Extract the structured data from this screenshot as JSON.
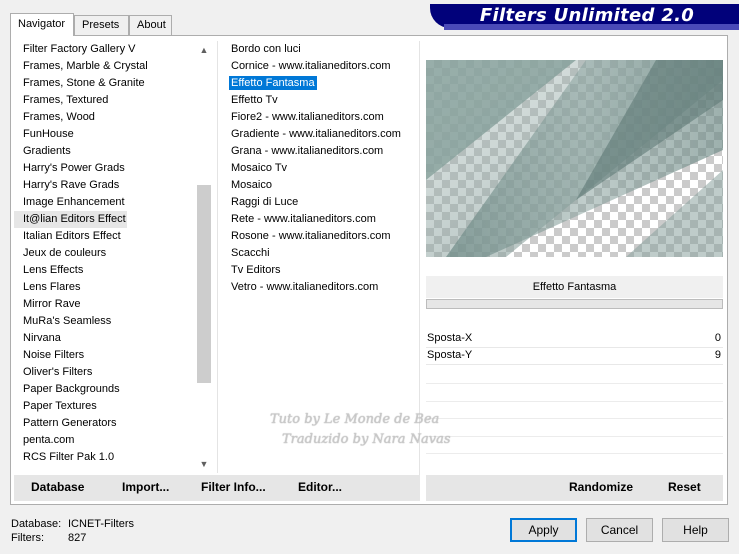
{
  "banner": {
    "title": "Filters Unlimited 2.0"
  },
  "tabs": [
    {
      "label": "Navigator",
      "active": true
    },
    {
      "label": "Presets",
      "active": false
    },
    {
      "label": "About",
      "active": false
    }
  ],
  "categories": [
    "Filter Factory Gallery V",
    "Frames, Marble & Crystal",
    "Frames, Stone & Granite",
    "Frames, Textured",
    "Frames, Wood",
    "FunHouse",
    "Gradients",
    "Harry's Power Grads",
    "Harry's Rave Grads",
    "Image Enhancement",
    "It@lian Editors Effect",
    "Italian Editors Effect",
    "Jeux de couleurs",
    "Lens Effects",
    "Lens Flares",
    "Mirror Rave",
    "MuRa's Seamless",
    "Nirvana",
    "Noise Filters",
    "Oliver's Filters",
    "Paper Backgrounds",
    "Paper Textures",
    "Pattern Generators",
    "penta.com",
    "RCS Filter Pak 1.0"
  ],
  "selected_category_index": 10,
  "filters": [
    "Bordo con luci",
    "Cornice - www.italianeditors.com",
    "Effetto Fantasma",
    "Effetto Tv",
    "Fiore2 - www.italianeditors.com",
    "Gradiente - www.italianeditors.com",
    "Grana - www.italianeditors.com",
    "Mosaico Tv",
    "Mosaico",
    "Raggi di Luce",
    "Rete - www.italianeditors.com",
    "Rosone - www.italianeditors.com",
    "Scacchi",
    "Tv Editors",
    "Vetro - www.italianeditors.com"
  ],
  "selected_filter_index": 2,
  "preview": {
    "filter_name": "Effetto Fantasma",
    "progress": 0
  },
  "params": [
    {
      "label": "Sposta-X",
      "value": "0"
    },
    {
      "label": "Sposta-Y",
      "value": "9"
    }
  ],
  "watermark": {
    "line1": "Tuto by Le Monde de Bea",
    "line2": "Traduzido by Nara Navas"
  },
  "toolbar": {
    "database": "Database",
    "import": "Import...",
    "filter_info": "Filter Info...",
    "editor": "Editor...",
    "randomize": "Randomize",
    "reset": "Reset"
  },
  "status": {
    "database_label": "Database:",
    "database_value": "ICNET-Filters",
    "filters_label": "Filters:",
    "filters_value": "827"
  },
  "buttons": {
    "apply": "Apply",
    "cancel": "Cancel",
    "help": "Help"
  },
  "colors": {
    "banner": "#01017a",
    "selection": "#0078d7",
    "preview_stripe": "#6e8a86"
  }
}
